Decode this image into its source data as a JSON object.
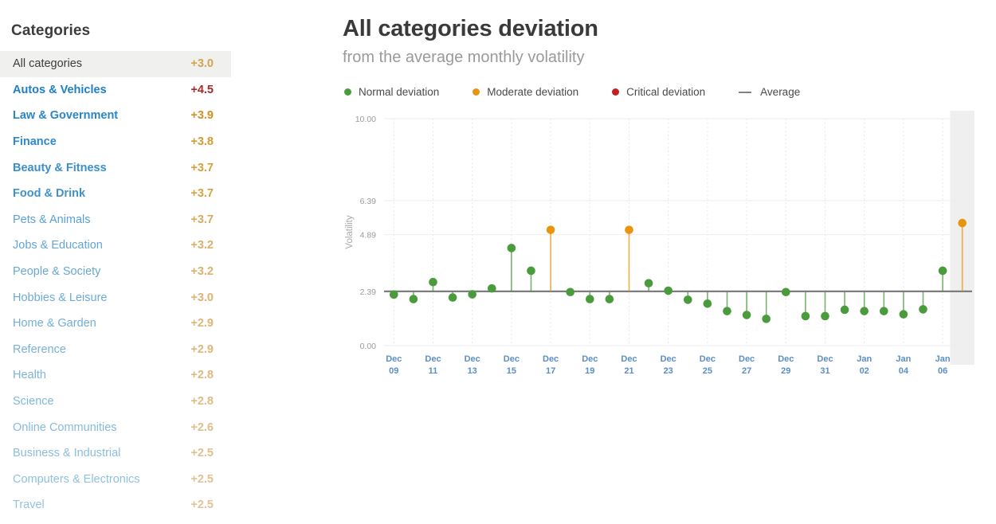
{
  "sidebar": {
    "title": "Categories",
    "items": [
      {
        "label": "All categories",
        "value": "+3.0",
        "selected": true,
        "label_color": "#3c3c3c",
        "value_color": "#d3a24a",
        "weight": 400
      },
      {
        "label": "Autos & Vehicles",
        "value": "+4.5",
        "selected": false,
        "label_color": "#1f7fc4",
        "value_color": "#a52a2a",
        "weight": 700
      },
      {
        "label": "Law & Government",
        "value": "+3.9",
        "selected": false,
        "label_color": "#2a86c6",
        "value_color": "#cf9222",
        "weight": 700
      },
      {
        "label": "Finance",
        "value": "+3.8",
        "selected": false,
        "label_color": "#2f89c8",
        "value_color": "#d29c33",
        "weight": 700
      },
      {
        "label": "Beauty & Fitness",
        "value": "+3.7",
        "selected": false,
        "label_color": "#3a8fcb",
        "value_color": "#d3a03c",
        "weight": 700
      },
      {
        "label": "Food & Drink",
        "value": "+3.7",
        "selected": false,
        "label_color": "#3f92cc",
        "value_color": "#d4a243",
        "weight": 700
      },
      {
        "label": "Pets & Animals",
        "value": "+3.7",
        "selected": false,
        "label_color": "#5ba0d2",
        "value_color": "#d7ab5e",
        "weight": 400
      },
      {
        "label": "Jobs & Education",
        "value": "+3.2",
        "selected": false,
        "label_color": "#63a5d4",
        "value_color": "#d9af68",
        "weight": 400
      },
      {
        "label": "People & Society",
        "value": "+3.2",
        "selected": false,
        "label_color": "#68a8d5",
        "value_color": "#dab16d",
        "weight": 400
      },
      {
        "label": "Hobbies & Leisure",
        "value": "+3.0",
        "selected": false,
        "label_color": "#6dabd6",
        "value_color": "#dbb372",
        "weight": 400
      },
      {
        "label": "Home & Garden",
        "value": "+2.9",
        "selected": false,
        "label_color": "#72aed8",
        "value_color": "#dcb577",
        "weight": 400
      },
      {
        "label": "Reference",
        "value": "+2.9",
        "selected": false,
        "label_color": "#77b1d9",
        "value_color": "#ddb77c",
        "weight": 400
      },
      {
        "label": "Health",
        "value": "+2.8",
        "selected": false,
        "label_color": "#7cb4da",
        "value_color": "#deb981",
        "weight": 400
      },
      {
        "label": "Science",
        "value": "+2.8",
        "selected": false,
        "label_color": "#81b7db",
        "value_color": "#dfbb86",
        "weight": 400
      },
      {
        "label": "Online Communities",
        "value": "+2.6",
        "selected": false,
        "label_color": "#86badd",
        "value_color": "#e0bd8b",
        "weight": 400
      },
      {
        "label": "Business & Industrial",
        "value": "+2.5",
        "selected": false,
        "label_color": "#8bbdde",
        "value_color": "#e1bf90",
        "weight": 400
      },
      {
        "label": "Computers & Electronics",
        "value": "+2.5",
        "selected": false,
        "label_color": "#90c0df",
        "value_color": "#e2c195",
        "weight": 400
      },
      {
        "label": "Travel",
        "value": "+2.5",
        "selected": false,
        "label_color": "#95c3e0",
        "value_color": "#e3c39a",
        "weight": 400
      }
    ]
  },
  "chart_header": {
    "title": "All categories deviation",
    "subtitle": "from the average monthly volatility"
  },
  "legend": [
    {
      "label": "Normal deviation",
      "marker": "dot",
      "color": "#4a9b3c"
    },
    {
      "label": "Moderate deviation",
      "marker": "dot",
      "color": "#e8940f"
    },
    {
      "label": "Critical deviation",
      "marker": "dot",
      "color": "#c32020"
    },
    {
      "label": "Average",
      "marker": "dash",
      "color": "#808080"
    }
  ],
  "chart_data": {
    "type": "line",
    "subtype": "lollipop-stem",
    "title": "All categories deviation",
    "subtitle": "from the average monthly volatility",
    "xlabel": "",
    "ylabel": "Volatility",
    "ylim": [
      0.0,
      10.0
    ],
    "ytick_values": [
      0.0,
      2.39,
      4.89,
      6.39,
      10.0
    ],
    "ytick_labels": [
      "0.00",
      "2.39",
      "4.89",
      "6.39",
      "10.00"
    ],
    "grid": true,
    "legend_position": "top-left",
    "baseline_label": "Average",
    "baseline_value": 2.39,
    "highlighted_index": 29,
    "x": [
      "Dec 09",
      "Dec 10",
      "Dec 11",
      "Dec 12",
      "Dec 13",
      "Dec 14",
      "Dec 15",
      "Dec 16",
      "Dec 17",
      "Dec 18",
      "Dec 19",
      "Dec 20",
      "Dec 21",
      "Dec 22",
      "Dec 23",
      "Dec 24",
      "Dec 25",
      "Dec 26",
      "Dec 27",
      "Dec 28",
      "Dec 29",
      "Dec 30",
      "Dec 31",
      "Jan 01",
      "Jan 02",
      "Jan 03",
      "Jan 04",
      "Jan 05",
      "Jan 06",
      "Jan 07"
    ],
    "xtick_labels": [
      {
        "line1": "Dec",
        "line2": "09"
      },
      {
        "line1": "Dec",
        "line2": "11"
      },
      {
        "line1": "Dec",
        "line2": "13"
      },
      {
        "line1": "Dec",
        "line2": "15"
      },
      {
        "line1": "Dec",
        "line2": "17"
      },
      {
        "line1": "Dec",
        "line2": "19"
      },
      {
        "line1": "Dec",
        "line2": "21"
      },
      {
        "line1": "Dec",
        "line2": "23"
      },
      {
        "line1": "Dec",
        "line2": "25"
      },
      {
        "line1": "Dec",
        "line2": "27"
      },
      {
        "line1": "Dec",
        "line2": "29"
      },
      {
        "line1": "Dec",
        "line2": "31"
      },
      {
        "line1": "Jan",
        "line2": "02"
      },
      {
        "line1": "Jan",
        "line2": "04"
      },
      {
        "line1": "Jan",
        "line2": "06"
      }
    ],
    "values": [
      2.25,
      2.05,
      2.8,
      2.12,
      2.26,
      2.52,
      4.3,
      3.3,
      5.1,
      2.36,
      2.05,
      2.05,
      5.1,
      2.75,
      2.42,
      2.02,
      1.85,
      1.52,
      1.35,
      1.18,
      2.36,
      1.3,
      1.3,
      1.58,
      1.52,
      1.52,
      1.38,
      1.6,
      3.3,
      5.4
    ],
    "point_colors": [
      "#4a9b3c",
      "#4a9b3c",
      "#4a9b3c",
      "#4a9b3c",
      "#4a9b3c",
      "#4a9b3c",
      "#4a9b3c",
      "#4a9b3c",
      "#e8940f",
      "#4a9b3c",
      "#4a9b3c",
      "#4a9b3c",
      "#e8940f",
      "#4a9b3c",
      "#4a9b3c",
      "#4a9b3c",
      "#4a9b3c",
      "#4a9b3c",
      "#4a9b3c",
      "#4a9b3c",
      "#4a9b3c",
      "#4a9b3c",
      "#4a9b3c",
      "#4a9b3c",
      "#4a9b3c",
      "#4a9b3c",
      "#4a9b3c",
      "#4a9b3c",
      "#4a9b3c",
      "#e8940f"
    ],
    "series": [
      {
        "name": "Normal deviation",
        "color": "#4a9b3c"
      },
      {
        "name": "Moderate deviation",
        "color": "#e8940f"
      },
      {
        "name": "Critical deviation",
        "color": "#c32020"
      }
    ]
  }
}
